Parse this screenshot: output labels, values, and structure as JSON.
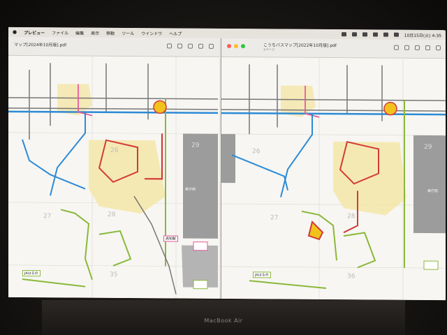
{
  "menubar": {
    "app_name": "プレビュー",
    "items": [
      "ファイル",
      "編集",
      "表示",
      "移動",
      "ツール",
      "ウインドウ",
      "ヘルプ"
    ],
    "clock": "10月15日(火) 4:35"
  },
  "left_window": {
    "title": "マップ[2024年10月版].pdf"
  },
  "right_window": {
    "title": "こうちバスマップ[2022年10月版].pdf",
    "subtitle": "1ページ"
  },
  "map_labels": {
    "grid_left": [
      "26",
      "28",
      "29",
      "27",
      "35"
    ],
    "grid_right": [
      "26",
      "28",
      "29",
      "27",
      "36"
    ],
    "place_left": "JAはるの",
    "place_right": "JAはるの",
    "station_left": "高知駅",
    "kencho_left": "県庁前",
    "kencho_right": "県庁前"
  },
  "device": {
    "brand": "MacBook Air"
  },
  "colors": {
    "red_line": "#d23a3a",
    "blue_line": "#2b8ad6",
    "green_line": "#8ab83a",
    "gray_line": "#777777",
    "pink_line": "#e25c9a",
    "yellow_area": "#f4e6a8",
    "gray_area": "#9c9c9c"
  }
}
